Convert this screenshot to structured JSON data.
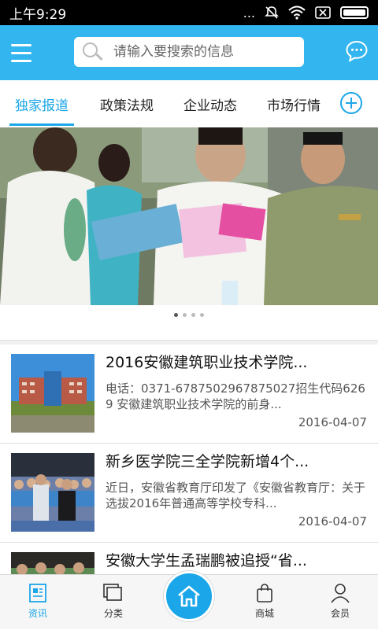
{
  "status_bar": {
    "time": "上午9:29",
    "dots": "..."
  },
  "header": {
    "search_placeholder": "请输入要搜索的信息"
  },
  "tabs": [
    {
      "label": "独家报道",
      "active": true
    },
    {
      "label": "政策法规",
      "active": false
    },
    {
      "label": "企业动态",
      "active": false
    },
    {
      "label": "市场行情",
      "active": false
    }
  ],
  "carousel": {
    "slide_count": 4,
    "active_index": 0
  },
  "news": [
    {
      "title": "2016安徽建筑职业技术学院...",
      "summary": "电话：0371-6787502967875027招生代码6269        安徽建筑职业技术学院的前身...",
      "date": "2016-04-07"
    },
    {
      "title": "新乡医学院三全学院新增4个...",
      "summary": "近日，安徽省教育厅印发了《安徽省教育厅：关于选拔2016年普通高等学校专科...",
      "date": "2016-04-07"
    },
    {
      "title": "安徽大学生孟瑞鹏被追授“省...",
      "summary": "",
      "date": ""
    }
  ],
  "bottom_nav": [
    {
      "label": "资讯",
      "icon": "news-icon",
      "active": true
    },
    {
      "label": "分类",
      "icon": "category-icon",
      "active": false
    },
    {
      "label": "",
      "icon": "home-icon",
      "active": false
    },
    {
      "label": "商城",
      "icon": "shop-bag-icon",
      "active": false
    },
    {
      "label": "会员",
      "icon": "user-icon",
      "active": false
    }
  ],
  "colors": {
    "primary": "#33b5f0",
    "accent": "#1aa6e8"
  }
}
